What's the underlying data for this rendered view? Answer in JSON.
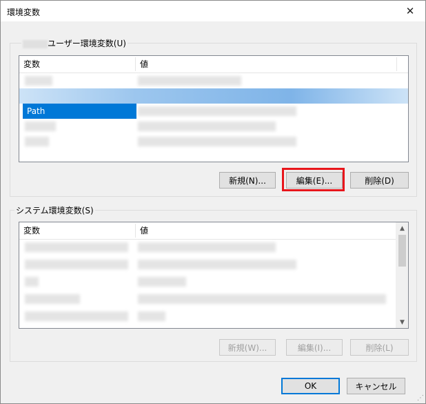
{
  "window": {
    "title": "環境変数",
    "close_glyph": "✕"
  },
  "user_vars": {
    "group_label": "ユーザー環境変数(U)",
    "columns": [
      "変数",
      "値"
    ],
    "rows": [
      {
        "var": "",
        "value": ""
      },
      {
        "var": "",
        "value": ""
      },
      {
        "var": "Path",
        "value": ""
      },
      {
        "var": "",
        "value": ""
      },
      {
        "var": "",
        "value": ""
      }
    ],
    "buttons": {
      "new": "新規(N)...",
      "edit": "編集(E)...",
      "delete": "削除(D)"
    }
  },
  "system_vars": {
    "group_label": "システム環境変数(S)",
    "columns": [
      "変数",
      "値"
    ],
    "rows": [
      {
        "var": "",
        "value": ""
      },
      {
        "var": "",
        "value": ""
      },
      {
        "var": "",
        "value": ""
      },
      {
        "var": "",
        "value": ""
      },
      {
        "var": "",
        "value": ""
      }
    ],
    "buttons": {
      "new": "新規(W)...",
      "edit": "編集(I)...",
      "delete": "削除(L)"
    },
    "scroll_up": "▲",
    "scroll_down": "▼"
  },
  "dialog_buttons": {
    "ok": "OK",
    "cancel": "キャンセル"
  },
  "colors": {
    "selection": "#0078d7",
    "callout": "#e8151b"
  }
}
